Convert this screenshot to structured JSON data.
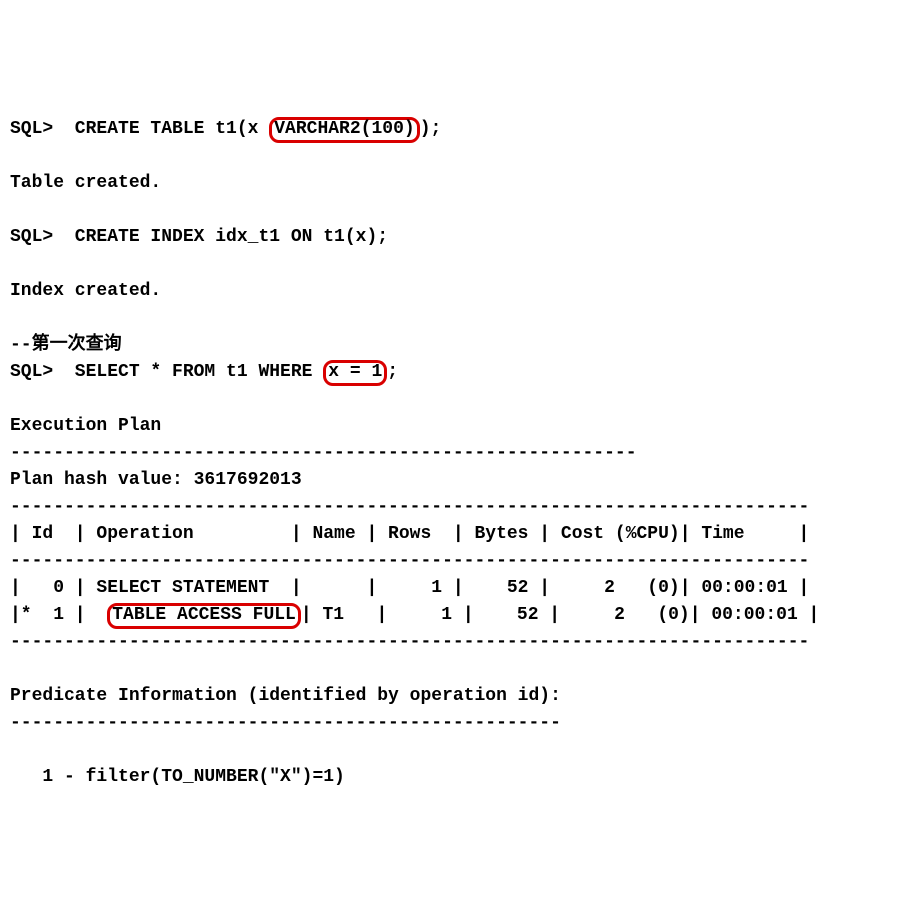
{
  "sql1_prefix": "SQL>  CREATE TABLE t1(x ",
  "sql1_hl": "VARCHAR2(100)",
  "sql1_suffix": ");",
  "msg_table_created": "Table created.",
  "sql2": "SQL>  CREATE INDEX idx_t1 ON t1(x);",
  "msg_index_created": "Index created.",
  "comment_first_query": "--第一次查询",
  "sql3_prefix": "SQL>  SELECT * FROM t1 WHERE ",
  "sql3_hl": "x = 1",
  "sql3_suffix": ";",
  "plan_header": "Execution Plan",
  "plan_dash1": "----------------------------------------------------------",
  "plan_hash": "Plan hash value: 3617692013",
  "plan_sep": "--------------------------------------------------------------------------",
  "plan_cols": "| Id  | Operation         | Name | Rows  | Bytes | Cost (%CPU)| Time     |",
  "plan_row0": "|   0 | SELECT STATEMENT  |      |     1 |    52 |     2   (0)| 00:00:01 |",
  "plan_row1_prefix": "|*  1 |  ",
  "plan_row1_hl": "TABLE ACCESS FULL",
  "plan_row1_suffix": "| T1   |     1 |    52 |     2   (0)| 00:00:01 |",
  "predicate_header": "Predicate Information (identified by operation id):",
  "predicate_dash": "---------------------------------------------------",
  "predicate_line": "   1 - filter(TO_NUMBER(\"X\")=1)"
}
